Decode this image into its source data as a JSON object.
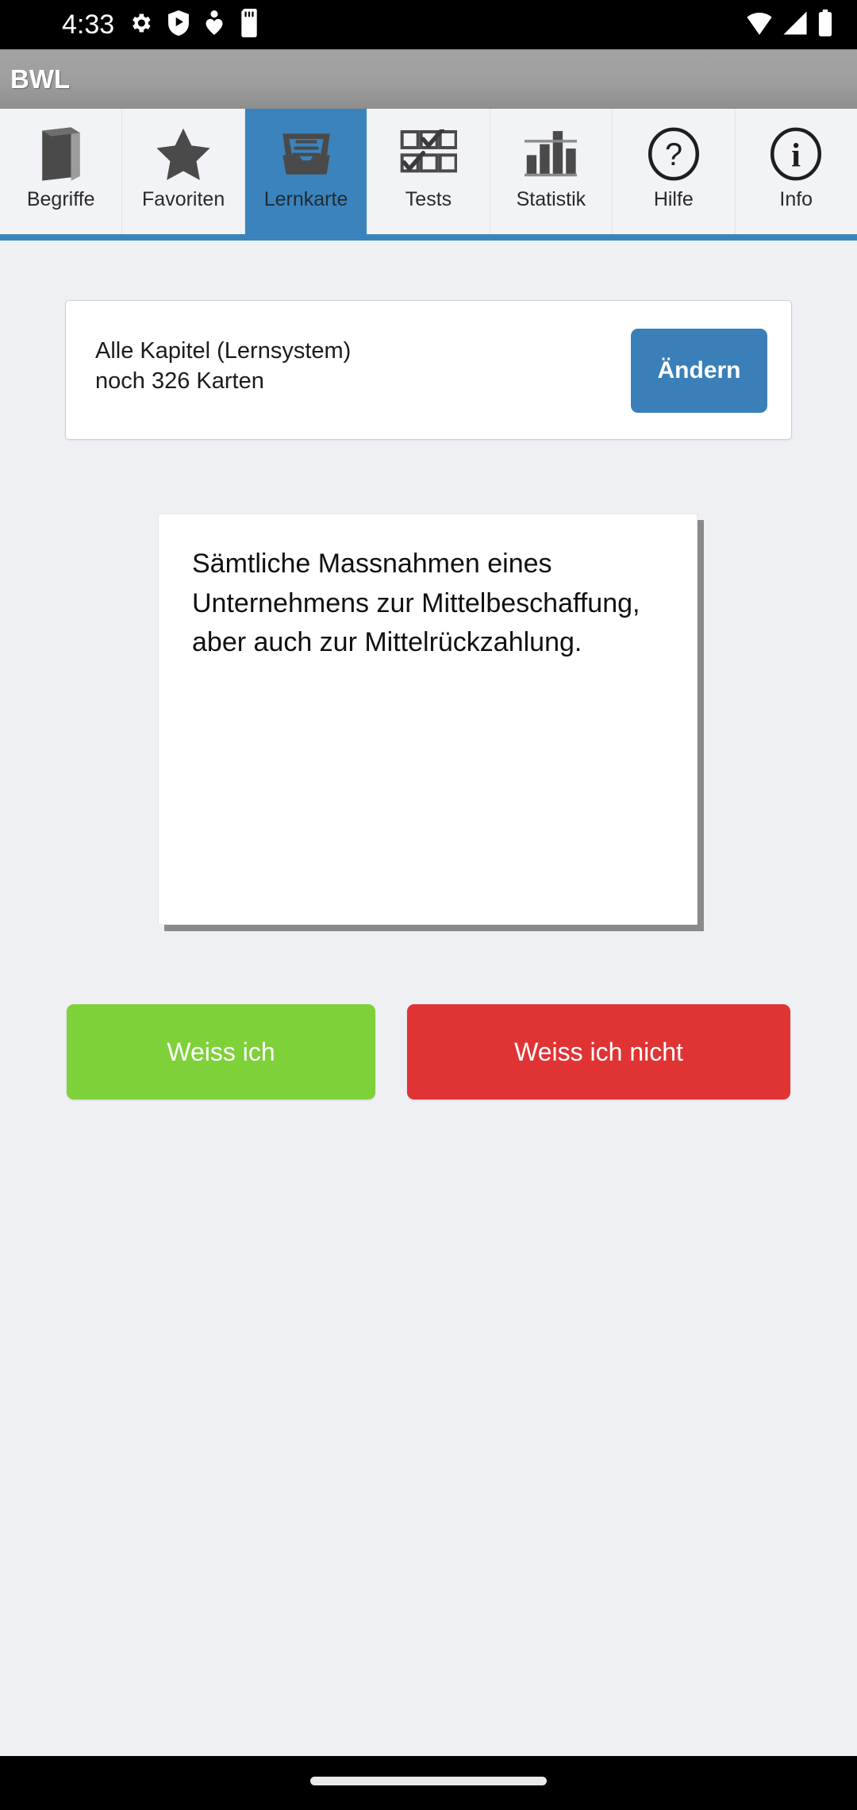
{
  "status_bar": {
    "time": "4:33",
    "left_icons": [
      "gear-icon",
      "play-protect-icon",
      "heart-pin-icon",
      "sd-card-icon"
    ],
    "right_icons": [
      "wifi-icon",
      "cellular-signal-icon",
      "battery-icon"
    ]
  },
  "app": {
    "title": "BWL"
  },
  "tabs": [
    {
      "label": "Begriffe",
      "icon": "book-icon",
      "selected": false
    },
    {
      "label": "Favoriten",
      "icon": "star-icon",
      "selected": false
    },
    {
      "label": "Lernkarte",
      "icon": "file-box-icon",
      "selected": true
    },
    {
      "label": "Tests",
      "icon": "checkbox-grid-icon",
      "selected": false
    },
    {
      "label": "Statistik",
      "icon": "bar-chart-icon",
      "selected": false
    },
    {
      "label": "Hilfe",
      "icon": "question-circle-icon",
      "selected": false
    },
    {
      "label": "Info",
      "icon": "info-circle-icon",
      "selected": false
    }
  ],
  "chapter": {
    "title": "Alle Kapitel (Lernsystem)",
    "remaining": "noch 326 Karten",
    "change_label": "Ändern"
  },
  "flashcard": {
    "text": "Sämtliche Massnahmen eines Unternehmens zur Mittelbeschaffung, aber auch zur Mittelrückzahlung."
  },
  "answers": {
    "know_label": "Weiss ich",
    "dont_know_label": "Weiss ich nicht"
  },
  "colors": {
    "accent_blue": "#3b83bd",
    "button_blue": "#3b7fb8",
    "green": "#7ed139",
    "red": "#e03434",
    "content_bg": "#eff0f4",
    "title_bar_gray": "#9e9e9e"
  }
}
